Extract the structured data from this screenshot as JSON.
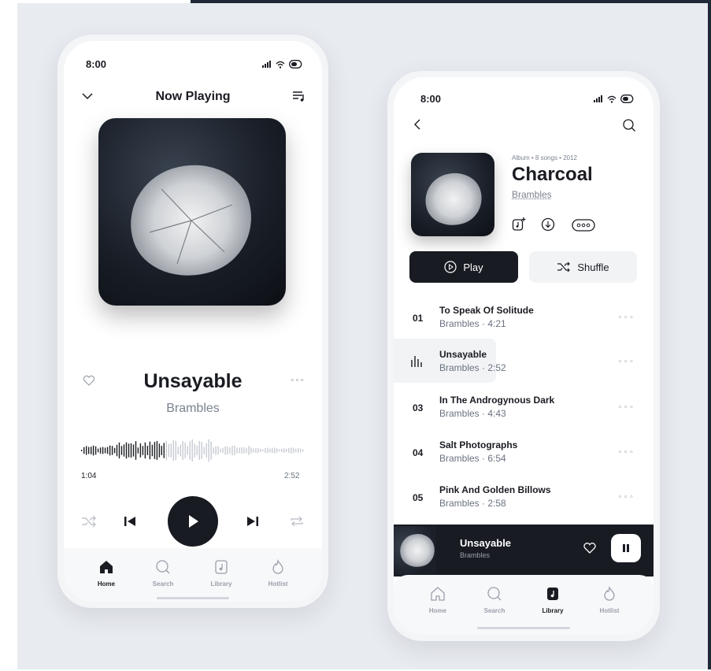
{
  "colors": {
    "dark": "#181b22",
    "muted": "#7b8190",
    "canvas": "#e8ebf0"
  },
  "p1": {
    "status_time": "8:00",
    "header_title": "Now Playing",
    "song_title": "Unsayable",
    "artist": "Brambles",
    "elapsed": "1:04",
    "duration": "2:52",
    "playback_progress": 0.37,
    "nav": [
      {
        "label": "Home",
        "icon": "home-icon",
        "active": true
      },
      {
        "label": "Search",
        "icon": "search-icon",
        "active": false
      },
      {
        "label": "Library",
        "icon": "library-icon",
        "active": false
      },
      {
        "label": "Hotlist",
        "icon": "flame-icon",
        "active": false
      }
    ]
  },
  "p2": {
    "status_time": "8:00",
    "album_meta": "Album • 8 songs • 2012",
    "album_title": "Charcoal",
    "album_artist": "Brambles",
    "play_label": "Play",
    "shuffle_label": "Shuffle",
    "tracks": [
      {
        "num": "01",
        "title": "To Speak Of Solitude",
        "artist": "Brambles",
        "duration": "4:21",
        "playing": false
      },
      {
        "num": "",
        "title": "Unsayable",
        "artist": "Brambles",
        "duration": "2:52",
        "playing": true
      },
      {
        "num": "03",
        "title": "In The Androgynous Dark",
        "artist": "Brambles",
        "duration": "4:43",
        "playing": false
      },
      {
        "num": "04",
        "title": "Salt Photographs",
        "artist": "Brambles",
        "duration": "6:54",
        "playing": false
      },
      {
        "num": "05",
        "title": "Pink And Golden Billows",
        "artist": "Brambles",
        "duration": "2:58",
        "playing": false
      }
    ],
    "mini": {
      "title": "Unsayable",
      "artist": "Brambles"
    },
    "nav": [
      {
        "label": "Home",
        "icon": "home-icon",
        "active": false
      },
      {
        "label": "Search",
        "icon": "search-icon",
        "active": false
      },
      {
        "label": "Library",
        "icon": "library-icon",
        "active": true
      },
      {
        "label": "Hotlist",
        "icon": "flame-icon",
        "active": false
      }
    ]
  }
}
